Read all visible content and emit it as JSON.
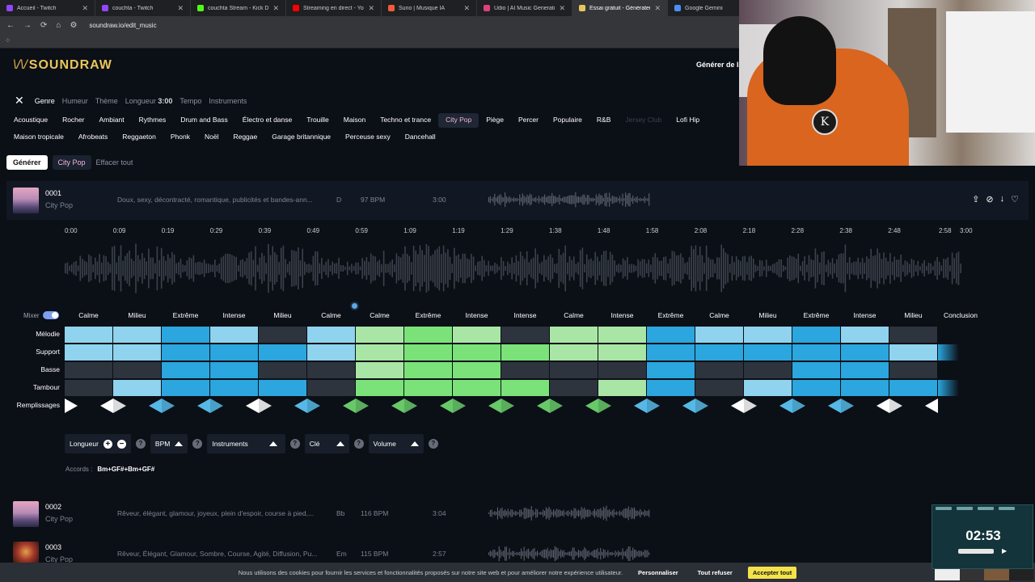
{
  "browser": {
    "tabs": [
      {
        "label": "Accueil - Twitch",
        "color": "#9146ff",
        "active": false
      },
      {
        "label": "couchta - Twitch",
        "color": "#9146ff",
        "active": false
      },
      {
        "label": "couchta Stream - Kick Dashboard",
        "color": "#53fc18",
        "active": false
      },
      {
        "label": "Streaming en direct - YouTube",
        "color": "#ff0000",
        "active": false
      },
      {
        "label": "Suno | Musique IA",
        "color": "#f25b3a",
        "active": false
      },
      {
        "label": "Udio | AI Music Generator - Offici",
        "color": "#e0407a",
        "active": false
      },
      {
        "label": "Essai gratuit - Générateur de mu",
        "color": "#e9c65a",
        "active": true
      },
      {
        "label": "Google Gemini",
        "color": "#4c8df6",
        "active": false
      }
    ],
    "url": "soundraw.io/edit_music"
  },
  "header": {
    "logo_mark": "\\/\\/",
    "logo_text": "SOUNDRAW",
    "right_text": "Générer de la"
  },
  "filters": {
    "close_icon": "close-icon",
    "items": [
      "Genre",
      "Humeur",
      "Thème"
    ],
    "length_label": "Longueur",
    "length_value": "3:00",
    "tempo": "Tempo",
    "instruments": "Instruments"
  },
  "genres": {
    "row1": [
      "Acoustique",
      "Rocher",
      "Ambiant",
      "Rythmes",
      "Drum and Bass",
      "Électro et danse",
      "Trouille",
      "Maison",
      "Techno et trance",
      "City Pop",
      "Piège",
      "Percer",
      "Populaire",
      "R&B",
      "Jersey Club",
      "Lofi Hip"
    ],
    "row2": [
      "Maison tropicale",
      "Afrobeats",
      "Reggaeton",
      "Phonk",
      "Noël",
      "Reggae",
      "Garage britannique",
      "Perceuse sexy",
      "Dancehall"
    ],
    "selected": "City Pop",
    "disabled": "Jersey Club"
  },
  "actions": {
    "generate": "Générer",
    "chip": "City Pop",
    "clear": "Effacer tout"
  },
  "songs": [
    {
      "id": "0001",
      "genre": "City Pop",
      "desc": "Doux, sexy, décontracté, romantique, publicités et bandes-ann...",
      "key": "D",
      "bpm": "97 BPM",
      "duration": "3:00"
    },
    {
      "id": "0002",
      "genre": "City Pop",
      "desc": "Rêveur, élégant, glamour, joyeux, plein d'espoir, course à pied,...",
      "key": "Bb",
      "bpm": "116 BPM",
      "duration": "3:04"
    },
    {
      "id": "0003",
      "genre": "City Pop",
      "desc": "Rêveur, Élégant, Glamour, Sombre, Course, Agité, Diffusion, Pu...",
      "key": "Em",
      "bpm": "115 BPM",
      "duration": "2:57"
    }
  ],
  "song_icons": [
    "share-icon",
    "link-icon",
    "download-icon",
    "heart-icon"
  ],
  "timeline": [
    "0:00",
    "0:09",
    "0:19",
    "0:29",
    "0:39",
    "0:49",
    "0:59",
    "1:09",
    "1:19",
    "1:29",
    "1:38",
    "1:48",
    "1:58",
    "2:08",
    "2:18",
    "2:28",
    "2:38",
    "2:48",
    "2:58",
    "3:00"
  ],
  "arranger": {
    "mixer_label": "Mixer",
    "sections": [
      "Calme",
      "Milieu",
      "Extrême",
      "Intense",
      "Milieu",
      "Calme",
      "Calme",
      "Extrême",
      "Intense",
      "Intense",
      "Calme",
      "Intense",
      "Extrême",
      "Calme",
      "Milieu",
      "Extrême",
      "Intense",
      "Milieu",
      "Conclusion"
    ],
    "tracks": [
      "Mélodie",
      "Support",
      "Basse",
      "Tambour",
      "Remplissages"
    ],
    "colors": {
      "off": "#2e343d",
      "blue1": "#8fd3ee",
      "blue2": "#2ba6de",
      "green1": "#a9e6a5",
      "green2": "#7be27a",
      "end": "#2ba6de"
    },
    "grid": [
      [
        "blue1",
        "blue1",
        "blue2",
        "blue1",
        "off",
        "blue1",
        "green1",
        "green2",
        "green1",
        "off",
        "green1",
        "green1",
        "blue2",
        "blue1",
        "blue1",
        "blue2",
        "blue1",
        "off"
      ],
      [
        "blue1",
        "blue1",
        "blue2",
        "blue2",
        "blue2",
        "blue1",
        "green1",
        "green2",
        "green2",
        "green2",
        "green1",
        "green1",
        "blue2",
        "blue2",
        "blue2",
        "blue2",
        "blue2",
        "blue1"
      ],
      [
        "off",
        "off",
        "blue2",
        "blue2",
        "off",
        "off",
        "green1",
        "green2",
        "green2",
        "off",
        "off",
        "off",
        "blue2",
        "off",
        "off",
        "blue2",
        "blue2",
        "off"
      ],
      [
        "off",
        "blue1",
        "blue2",
        "blue2",
        "blue2",
        "off",
        "green2",
        "green2",
        "green2",
        "green2",
        "off",
        "green1",
        "blue2",
        "off",
        "blue1",
        "blue2",
        "blue2",
        "blue2"
      ]
    ],
    "fills": [
      "white",
      "white",
      "blue",
      "blue",
      "white",
      "blue",
      "green",
      "green",
      "green",
      "green",
      "green",
      "green",
      "blue",
      "blue",
      "white",
      "blue",
      "blue",
      "white",
      "white"
    ]
  },
  "controls": {
    "length": "Longueur",
    "bpm": "BPM",
    "instruments": "Instruments",
    "key": "Clé",
    "volume": "Volume",
    "help": "?",
    "chords_label": "Accords :",
    "chords_value": "Bm+GF#+Bm+GF#"
  },
  "cookie": {
    "text": "Nous utilisons des cookies pour fournir les services et fonctionnalités proposés sur notre site web et pour améliorer notre expérience utilisateur.",
    "customize": "Personnaliser",
    "refuse": "Tout refuser",
    "accept": "Accepter tout"
  },
  "webcam": {
    "badge": "K"
  },
  "timer": {
    "time": "02:53"
  }
}
